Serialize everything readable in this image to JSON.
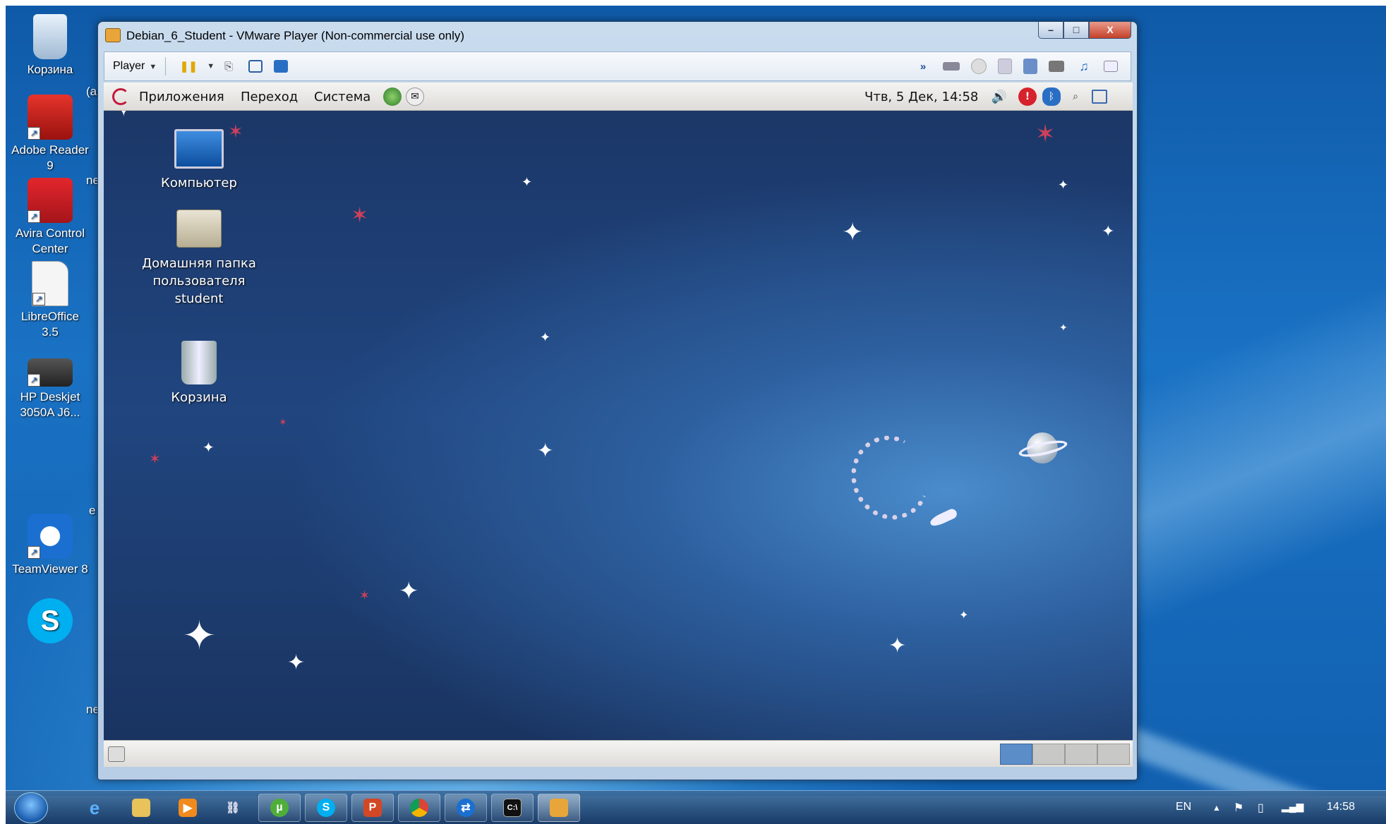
{
  "desktop": {
    "icons": [
      {
        "label": "Корзина"
      },
      {
        "label": "Adobe Reader 9"
      },
      {
        "label": "Avira Control Center"
      },
      {
        "label": "LibreOffice 3.5"
      },
      {
        "label": "HP Deskjet 3050A J6..."
      },
      {
        "label": "TeamViewer 8"
      }
    ],
    "partial_labels": [
      "(a",
      "ne",
      "e",
      "ne"
    ]
  },
  "vmware": {
    "title": "Debian_6_Student - VMware Player (Non-commercial use only)",
    "player_menu": "Player",
    "caption": {
      "minimize": "–",
      "maximize": "□",
      "close": "X"
    }
  },
  "guest": {
    "menus": [
      "Приложения",
      "Переход",
      "Система"
    ],
    "clock": "Чтв, 5 Дек, 14:58",
    "desktop_icons": [
      {
        "label": "Компьютер"
      },
      {
        "label": "Домашняя папка пользователя student"
      },
      {
        "label": "Корзина"
      }
    ]
  },
  "taskbar": {
    "language": "EN",
    "time": "14:58",
    "apps": [
      "ie",
      "explorer",
      "media-player",
      "network",
      "utorrent",
      "skype",
      "powerpoint",
      "chrome",
      "teamviewer",
      "cmd",
      "vmware-player"
    ]
  },
  "colors": {
    "win_desktop": "#1a72c4",
    "guest_bg": "#1b3666",
    "gnome_panel": "#e9e8e5",
    "active_workspace": "#5b8dc9"
  }
}
